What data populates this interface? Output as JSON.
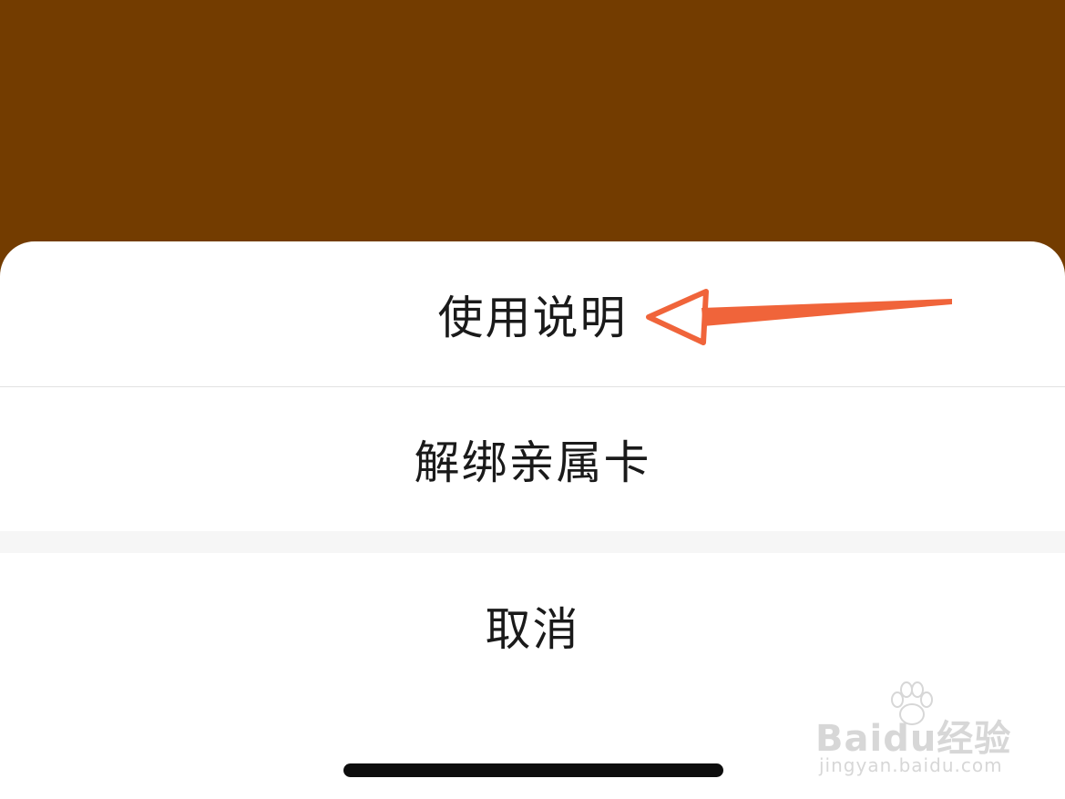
{
  "action_sheet": {
    "options": [
      {
        "label": "使用说明"
      },
      {
        "label": "解绑亲属卡"
      }
    ],
    "cancel_label": "取消"
  },
  "colors": {
    "backdrop": "#733C00",
    "sheet": "#FFFFFF",
    "text": "#1A1A1A",
    "annotation_arrow": "#F0643A",
    "home_indicator": "#0D0D0D"
  },
  "annotation": {
    "icon": "arrow-left-icon",
    "target": "使用说明"
  },
  "watermark": {
    "icon": "paw-icon",
    "logo": "Baidu经验",
    "url": "jingyan.baidu.com"
  }
}
